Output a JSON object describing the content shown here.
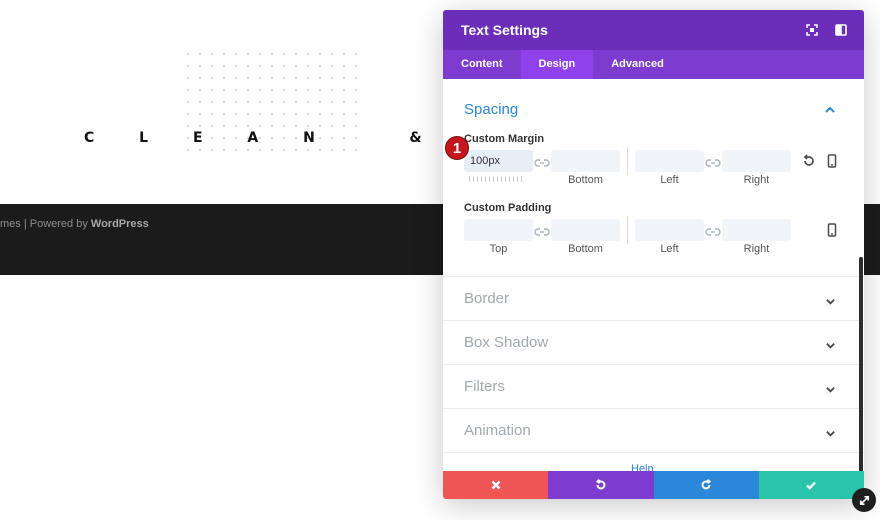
{
  "site": {
    "hero_title": "C L E A N   &   W H I T E",
    "footer_prefix": "mes | Powered by ",
    "footer_link": "WordPress"
  },
  "modal": {
    "title": "Text Settings",
    "tabs": [
      {
        "label": "Content",
        "active": false
      },
      {
        "label": "Design",
        "active": true
      },
      {
        "label": "Advanced",
        "active": false
      }
    ],
    "spacing": {
      "title": "Spacing",
      "margin": {
        "label": "Custom Margin",
        "top_value": "100px",
        "sub_labels": [
          "Bottom",
          "Left",
          "Right"
        ]
      },
      "padding": {
        "label": "Custom Padding",
        "sub_labels": [
          "Top",
          "Bottom",
          "Left",
          "Right"
        ]
      }
    },
    "sections": [
      "Border",
      "Box Shadow",
      "Filters",
      "Animation"
    ],
    "help_peek": "Help"
  },
  "badge": {
    "number": "1",
    "color": "#c4161c"
  },
  "colors": {
    "header": "#6c2eb9",
    "tabs": "#7e3bd0",
    "active_tab": "#8f42ec",
    "accent_blue": "#2b87da",
    "cancel": "#ef5555",
    "undo": "#7e3bd0",
    "redo": "#2b87da",
    "save": "#29c4a9"
  },
  "icons": [
    "expand-icon",
    "split-view-icon",
    "chevron-up-icon",
    "link-icon",
    "reset-icon",
    "mobile-icon",
    "chevron-down-icon",
    "close-icon",
    "undo-icon",
    "redo-icon",
    "check-icon",
    "resize-icon"
  ]
}
